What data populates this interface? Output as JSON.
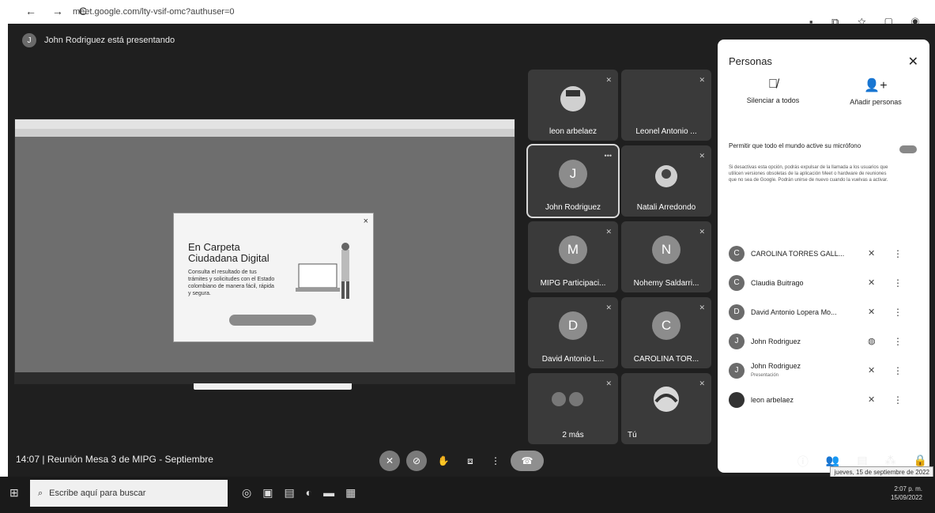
{
  "browser": {
    "url": "meet.google.com/lty-vsif-omc?authuser=0"
  },
  "banner": {
    "avatar_letter": "J",
    "text": "John Rodriguez está presentando"
  },
  "shared_screen": {
    "modal_title": "En Carpeta Ciudadana Digital",
    "modal_description": "Consulta el resultado de tus trámites y solicitudes con el Estado colombiano de manera fácil, rápida y segura."
  },
  "tiles": [
    {
      "name": "leon arbelaez",
      "avatar": ""
    },
    {
      "name": "Leonel Antonio ...",
      "avatar": ""
    },
    {
      "name": "John Rodriguez",
      "avatar": "J"
    },
    {
      "name": "Natali Arredondo",
      "avatar": ""
    },
    {
      "name": "MIPG Participaci...",
      "avatar": "M"
    },
    {
      "name": "Nohemy Saldarri...",
      "avatar": "N"
    },
    {
      "name": "David Antonio L...",
      "avatar": "D"
    },
    {
      "name": "CAROLINA TOR...",
      "avatar": "C"
    },
    {
      "name": "2 más",
      "avatar": ""
    },
    {
      "name": "Tú",
      "avatar": ""
    }
  ],
  "panel": {
    "title": "Personas",
    "mute_all": "Silenciar a todos",
    "add_people": "Añadir personas",
    "permission": "Permitir que todo el mundo active su micrófono",
    "help": "Si desactivas esta opción, podrás expulsar de la llamada a los usuarios que utilicen versiones obsoletas de la aplicación Meet o hardware de reuniones que no sea de Google. Podrán unirse de nuevo cuando la vuelvas a activar.",
    "participants": [
      {
        "initial": "C",
        "name": "CAROLINA TORRES GALL...",
        "sub": ""
      },
      {
        "initial": "C",
        "name": "Claudia Buitrago",
        "sub": ""
      },
      {
        "initial": "D",
        "name": "David Antonio Lopera Mo...",
        "sub": ""
      },
      {
        "initial": "J",
        "name": "John Rodriguez",
        "sub": ""
      },
      {
        "initial": "J",
        "name": "John Rodriguez",
        "sub": "Presentación"
      },
      {
        "initial": "",
        "name": "leon arbelaez",
        "sub": ""
      }
    ]
  },
  "bottom": {
    "meeting": "14:07  |  Reunión Mesa 3 de MIPG - Septiembre"
  },
  "taskbar": {
    "search_placeholder": "Escribe aquí para buscar",
    "time": "2:07 p. m.",
    "date": "15/09/2022",
    "tooltip": "jueves, 15 de septiembre de 2022"
  }
}
